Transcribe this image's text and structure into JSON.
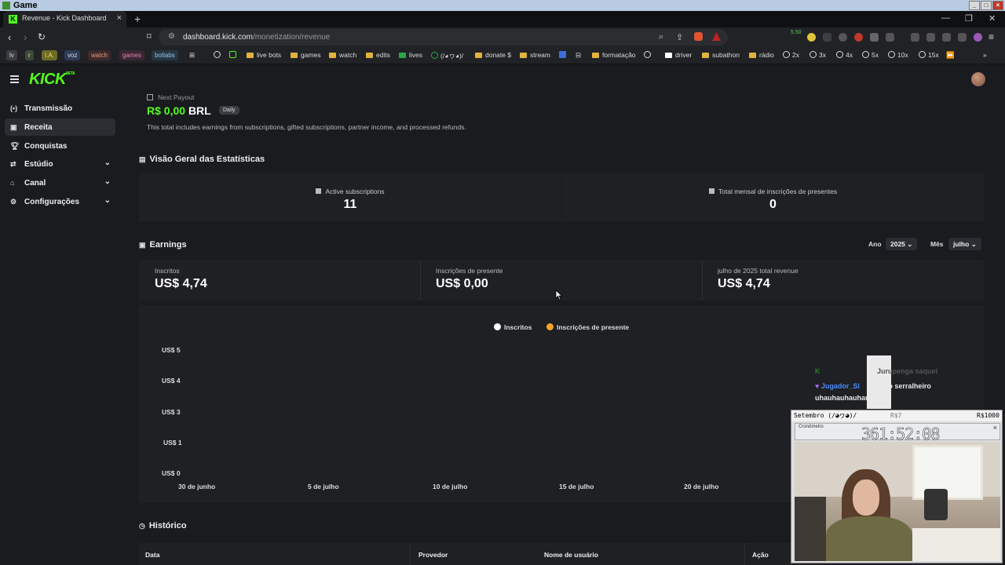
{
  "os": {
    "window_title": "Game"
  },
  "browser": {
    "tab_title": "Revenue - Kick Dashboard",
    "url_host": "dashboard.kick.com",
    "url_path": "/monetization/revenue",
    "extension_badge": "5.50"
  },
  "bookmarks": {
    "chips": [
      "lv",
      "r",
      "I.A.",
      "voz",
      "watch",
      "games",
      "botlabs"
    ],
    "items": [
      "live bots",
      "games",
      "watch",
      "edits",
      "lives",
      "(/◕ヮ◕)/",
      "donate $",
      "stream",
      "formatação",
      "driver",
      "subathon",
      "rádio",
      "2x",
      "3x",
      "4x",
      "5x",
      "10x",
      "15x"
    ]
  },
  "sidebar": {
    "items": [
      {
        "label": "Transmissão",
        "icon": "broadcast-icon"
      },
      {
        "label": "Receita",
        "icon": "revenue-icon"
      },
      {
        "label": "Conquistas",
        "icon": "trophy-icon"
      },
      {
        "label": "Estúdio",
        "icon": "studio-icon"
      },
      {
        "label": "Canal",
        "icon": "channel-icon"
      },
      {
        "label": "Configurações",
        "icon": "gear-icon"
      }
    ]
  },
  "payout": {
    "label": "Next Payout",
    "amount": "R$ 0,00",
    "currency": "BRL",
    "frequency": "Daily",
    "note": "This total includes earnings from subscriptions, gifted subscriptions, partner income, and processed refunds."
  },
  "stats": {
    "title": "Visão Geral das Estatísticas",
    "cards": [
      {
        "label": "Active subscriptions",
        "value": "11"
      },
      {
        "label": "Total mensal de inscrições de presentes",
        "value": "0"
      }
    ]
  },
  "earnings": {
    "title": "Earnings",
    "year_label": "Ano",
    "year_value": "2025",
    "month_label": "Mês",
    "month_value": "julho",
    "cols": [
      {
        "label": "Inscritos",
        "value": "US$ 4,74"
      },
      {
        "label": "Inscrições de presente",
        "value": "US$ 0,00"
      },
      {
        "label": "julho de 2025 total revenue",
        "value": "US$ 4,74"
      }
    ]
  },
  "chart_data": {
    "type": "line",
    "legend": [
      {
        "name": "Inscritos",
        "color": "#ffffff"
      },
      {
        "name": "Inscrições de presente",
        "color": "#f5a623"
      }
    ],
    "y_ticks": [
      "US$ 5",
      "US$ 4",
      "US$ 3",
      "US$ 1",
      "US$ 0"
    ],
    "x_ticks": [
      "30 de junho",
      "5 de julho",
      "10 de julho",
      "15 de julho",
      "20 de julho"
    ],
    "series": []
  },
  "history": {
    "title": "Histórico",
    "columns": [
      "Data",
      "Provedor",
      "Nome de usuário",
      "Ação"
    ]
  },
  "overlay": {
    "chat1_name": "",
    "chat1_text": "Jurupenga saquei",
    "chat2_name": "Jugador_Si",
    "chat2_text": "o serralheiro",
    "chat3_text": "uhauhauhauhauhuha",
    "cam_bar_left": "Setembro (/◕ヮ◕)/",
    "cam_bar_mid": "R$7",
    "cam_bar_right": "R$1000",
    "stopwatch_title": "Cronômetro",
    "stopwatch_time": "361:52:08"
  }
}
